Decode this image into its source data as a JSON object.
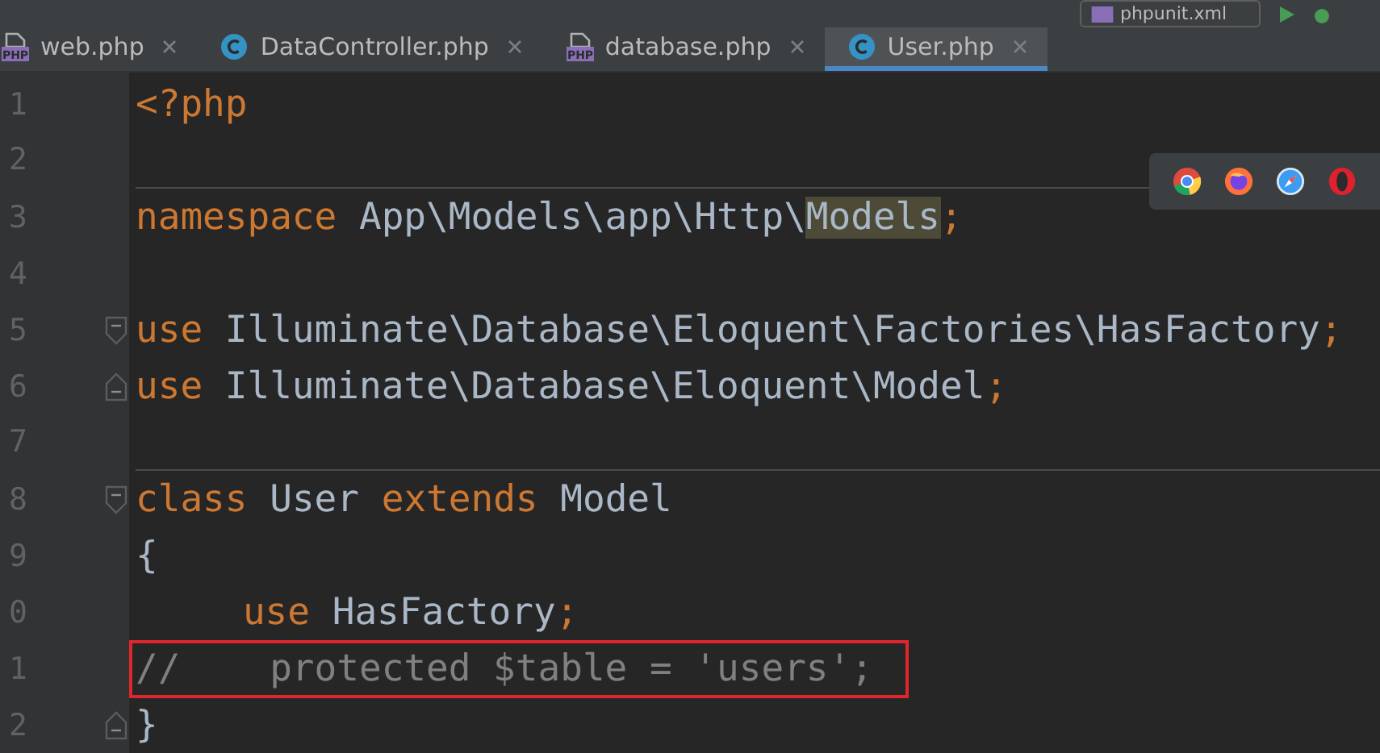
{
  "toolbar": {
    "run_config": "phpunit.xml"
  },
  "tabs": [
    {
      "label": "web.php",
      "kind": "php",
      "icon_text": "PHP",
      "selected": false
    },
    {
      "label": "DataController.php",
      "kind": "class",
      "selected": false
    },
    {
      "label": "database.php",
      "kind": "php",
      "icon_text": "PHP",
      "selected": false
    },
    {
      "label": "User.php",
      "kind": "class",
      "selected": true
    }
  ],
  "editor": {
    "lines": [
      {
        "number": "1",
        "tokens": [
          {
            "kind": "keyword",
            "text": "<?php"
          }
        ]
      },
      {
        "number": "2",
        "separator": true
      },
      {
        "number": "3",
        "tokens": [
          {
            "kind": "keyword",
            "text": "namespace"
          },
          {
            "kind": "text",
            "text": " App\\Models\\app\\Http\\"
          },
          {
            "kind": "highlight",
            "text": "Models"
          },
          {
            "kind": "keyword",
            "text": ";"
          }
        ]
      },
      {
        "number": "4"
      },
      {
        "number": "5",
        "fold_start": true,
        "tokens": [
          {
            "kind": "keyword",
            "text": "use"
          },
          {
            "kind": "text",
            "text": " Illuminate\\Database\\Eloquent\\Factories\\HasFactory"
          },
          {
            "kind": "keyword",
            "text": ";"
          }
        ]
      },
      {
        "number": "6",
        "fold_end": true,
        "tokens": [
          {
            "kind": "keyword",
            "text": "use"
          },
          {
            "kind": "text",
            "text": " Illuminate\\Database\\Eloquent\\Model"
          },
          {
            "kind": "keyword",
            "text": ";"
          }
        ]
      },
      {
        "number": "7",
        "separator": true
      },
      {
        "number": "8",
        "fold_start": true,
        "tokens": [
          {
            "kind": "keyword",
            "text": "class"
          },
          {
            "kind": "text",
            "text": " User "
          },
          {
            "kind": "keyword",
            "text": "extends"
          },
          {
            "kind": "text",
            "text": " Model"
          }
        ]
      },
      {
        "number": "9",
        "tokens": [
          {
            "kind": "text",
            "text": "{"
          }
        ]
      },
      {
        "number": "0",
        "indented": true,
        "tokens": [
          {
            "kind": "keyword",
            "text": "use"
          },
          {
            "kind": "text",
            "text": " HasFactory"
          },
          {
            "kind": "keyword",
            "text": ";"
          }
        ]
      },
      {
        "number": "1",
        "boxed": true,
        "tokens": [
          {
            "kind": "comment",
            "text": "//    protected $table = 'users';"
          }
        ]
      },
      {
        "number": "2",
        "fold_end": true,
        "tokens": [
          {
            "kind": "text",
            "text": "}"
          }
        ]
      }
    ]
  }
}
